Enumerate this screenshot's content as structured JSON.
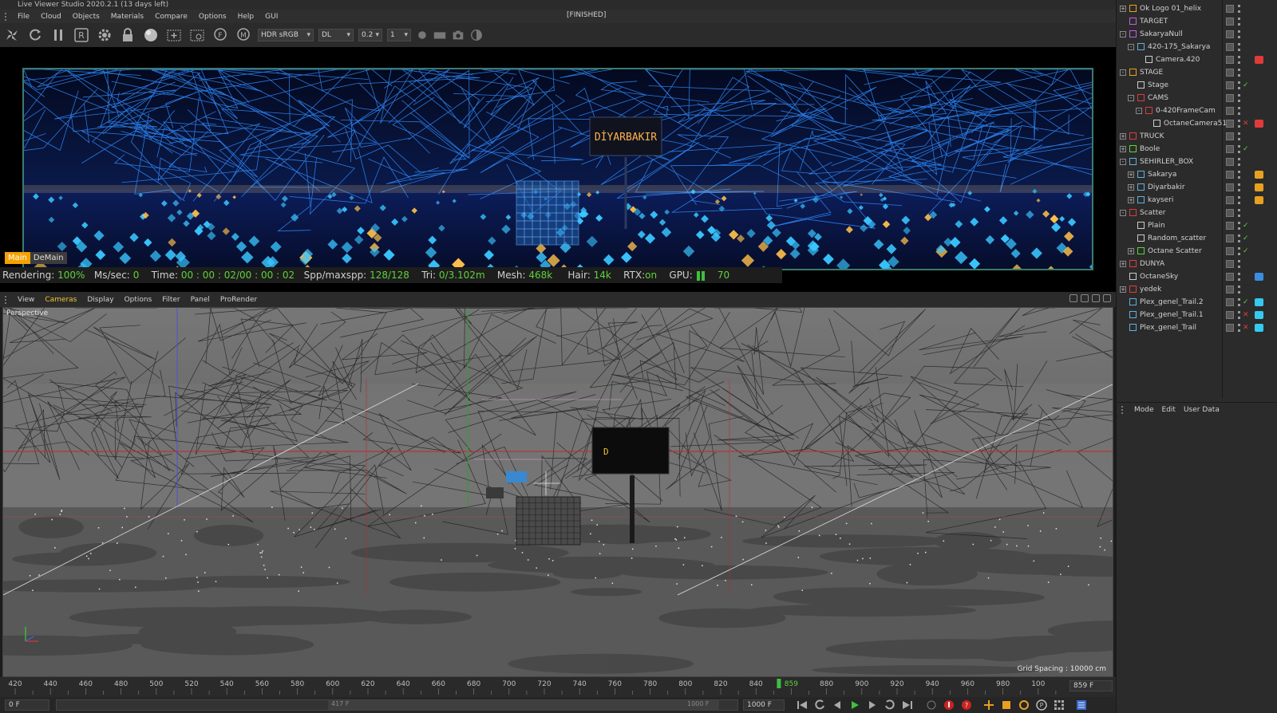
{
  "window": {
    "title": "Live Viewer Studio 2020.2.1 (13 days left)",
    "status": "[FINISHED]"
  },
  "menu": [
    "File",
    "Cloud",
    "Objects",
    "Materials",
    "Compare",
    "Options",
    "Help",
    "GUI"
  ],
  "toolbar": {
    "icons": [
      "pinwheel-icon",
      "refresh-icon",
      "pause-icon",
      "r-box-icon",
      "gear-icon",
      "lock-icon",
      "sphere-icon",
      "add-region-icon",
      "region-icon",
      "f-badge-icon",
      "m-badge-icon"
    ],
    "color_space": "HDR sRGB",
    "kernel": "DL",
    "value_1": "0.2",
    "value_2": "1",
    "icons_right": [
      "dot-icon",
      "rect-icon",
      "camera-icon",
      "half-circle-icon"
    ]
  },
  "render": {
    "sign_text": "DİYARBAKIR",
    "tabs": {
      "main": "Main",
      "demain": "DeMain"
    },
    "status": {
      "rendering_label": "Rendering:",
      "rendering_value": "100%",
      "ms_label": "Ms/sec:",
      "ms_value": "0",
      "time_label": "Time:",
      "time_value": "00 : 00 : 02/00 : 00 : 02",
      "spp_label": "Spp/maxspp:",
      "spp_value": "128/128",
      "tri_label": "Tri:",
      "tri_value": "0/3.102m",
      "mesh_label": "Mesh:",
      "mesh_value": "468k",
      "hair_label": "Hair:",
      "hair_value": "14k",
      "rtx_label": "RTX:",
      "rtx_value": "on",
      "gpu_label": "GPU:",
      "gpu_value": "70"
    },
    "colors": {
      "accent_orange": "#f5a100",
      "status_green": "#5fd13b",
      "frame_teal": "#3d7a6c"
    }
  },
  "viewport": {
    "menu": [
      "View",
      "Cameras",
      "Display",
      "Options",
      "Filter",
      "Panel",
      "ProRender"
    ],
    "active_menu": "Cameras",
    "label": "Perspective",
    "sign_text": "D",
    "grid_spacing": "Grid Spacing : 10000 cm"
  },
  "timeline": {
    "ticks": [
      "420",
      "440",
      "460",
      "480",
      "500",
      "520",
      "540",
      "560",
      "580",
      "600",
      "620",
      "640",
      "660",
      "680",
      "700",
      "720",
      "740",
      "760",
      "780",
      "800",
      "820",
      "840",
      "859",
      "880",
      "900",
      "920",
      "940",
      "960",
      "980",
      "100"
    ],
    "current_frame": "859",
    "end_field": "859 F",
    "start_field": "0 F",
    "range_start": "417 F",
    "range_end": "1000 F",
    "max_field": "1000 F"
  },
  "objects": [
    {
      "name": "Ok Logo 01_helix",
      "depth": 0,
      "exp": "+",
      "icon": "#e8a020",
      "state": "none",
      "tag": ""
    },
    {
      "name": "TARGET",
      "depth": 0,
      "exp": "",
      "icon": "#c060e0",
      "state": "none",
      "tag": ""
    },
    {
      "name": "SakaryaNull",
      "depth": 0,
      "exp": "-",
      "icon": "#c060e0",
      "state": "none",
      "tag": ""
    },
    {
      "name": "420-175_Sakarya",
      "depth": 1,
      "exp": "-",
      "icon": "#60b0e0",
      "state": "none",
      "tag": ""
    },
    {
      "name": "Camera.420",
      "depth": 2,
      "exp": "",
      "icon": "#cccccc",
      "state": "none",
      "tag": "#e03b3b"
    },
    {
      "name": "STAGE",
      "depth": 0,
      "exp": "-",
      "icon": "#e8a020",
      "state": "none",
      "tag": ""
    },
    {
      "name": "Stage",
      "depth": 1,
      "exp": "",
      "icon": "#cccccc",
      "state": "check",
      "tag": ""
    },
    {
      "name": "CAMS",
      "depth": 1,
      "exp": "-",
      "icon": "#e03b3b",
      "state": "none",
      "tag": ""
    },
    {
      "name": "0-420FrameCam",
      "depth": 2,
      "exp": "-",
      "icon": "#e03b3b",
      "state": "none",
      "tag": ""
    },
    {
      "name": "OctaneCamera516",
      "depth": 3,
      "exp": "",
      "icon": "#cccccc",
      "state": "cross",
      "tag": "#e03b3b"
    },
    {
      "name": "TRUCK",
      "depth": 0,
      "exp": "+",
      "icon": "#e03b3b",
      "state": "none",
      "tag": ""
    },
    {
      "name": "Boole",
      "depth": 0,
      "exp": "+",
      "icon": "#5fd13b",
      "state": "check",
      "tag": ""
    },
    {
      "name": "SEHIRLER_BOX",
      "depth": 0,
      "exp": "-",
      "icon": "#60b0e0",
      "state": "none",
      "tag": ""
    },
    {
      "name": "Sakarya",
      "depth": 1,
      "exp": "+",
      "icon": "#60b0e0",
      "state": "none",
      "tag": "#e8a020"
    },
    {
      "name": "Diyarbakir",
      "depth": 1,
      "exp": "+",
      "icon": "#60b0e0",
      "state": "none",
      "tag": "#e8a020"
    },
    {
      "name": "kayseri",
      "depth": 1,
      "exp": "+",
      "icon": "#60b0e0",
      "state": "none",
      "tag": "#e8a020"
    },
    {
      "name": "Scatter",
      "depth": 0,
      "exp": "-",
      "icon": "#e03b3b",
      "state": "none",
      "tag": ""
    },
    {
      "name": "Plain",
      "depth": 1,
      "exp": "",
      "icon": "#cccccc",
      "state": "check",
      "tag": ""
    },
    {
      "name": "Random_scatter",
      "depth": 1,
      "exp": "",
      "icon": "#cccccc",
      "state": "check",
      "tag": ""
    },
    {
      "name": "Octane Scatter",
      "depth": 1,
      "exp": "+",
      "icon": "#5fd13b",
      "state": "check",
      "tag": ""
    },
    {
      "name": "DUNYA",
      "depth": 0,
      "exp": "+",
      "icon": "#e03b3b",
      "state": "none",
      "tag": ""
    },
    {
      "name": "OctaneSky",
      "depth": 0,
      "exp": "",
      "icon": "#cccccc",
      "state": "none",
      "tag": "#3a8ee0"
    },
    {
      "name": "yedek",
      "depth": 0,
      "exp": "+",
      "icon": "#e03b3b",
      "state": "none",
      "tag": ""
    },
    {
      "name": "Plex_genel_Trail.2",
      "depth": 0,
      "exp": "",
      "icon": "#60b0e0",
      "state": "check",
      "tag": "#35c9f0"
    },
    {
      "name": "Plex_genel_Trail.1",
      "depth": 0,
      "exp": "",
      "icon": "#60b0e0",
      "state": "cross",
      "tag": "#35c9f0"
    },
    {
      "name": "Plex_genel_Trail",
      "depth": 0,
      "exp": "",
      "icon": "#60b0e0",
      "state": "cross",
      "tag": "#35c9f0"
    }
  ],
  "attributes": {
    "tabs": [
      "Mode",
      "Edit",
      "User Data"
    ]
  }
}
